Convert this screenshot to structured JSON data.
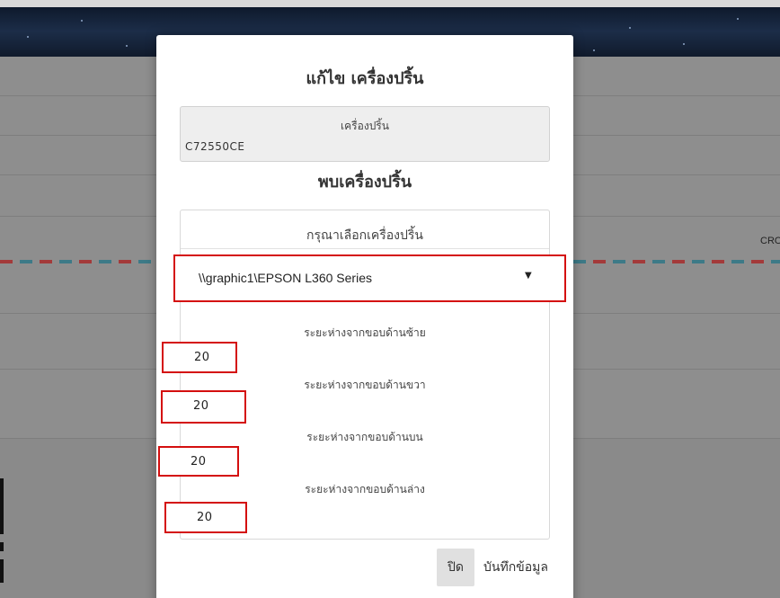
{
  "modal": {
    "title": "แก้ไข เครื่องปริ้น",
    "current_printer": {
      "label": "เครื่องปริ้น",
      "value": "C72550CE"
    },
    "found_title": "พบเครื่องปริ้น",
    "select_heading": "กรุณาเลือกเครื่องปริ้น",
    "printer_select": {
      "selected": "\\\\graphic1\\EPSON L360 Series",
      "caret": "▼"
    },
    "margins": [
      {
        "label": "ระยะห่างจากขอบด้านซ้าย",
        "value": "20"
      },
      {
        "label": "ระยะห่างจากขอบด้านขวา",
        "value": "20"
      },
      {
        "label": "ระยะห่างจากขอบด้านบน",
        "value": "20"
      },
      {
        "label": "ระยะห่างจากขอบด้านล่าง",
        "value": "20"
      }
    ],
    "buttons": {
      "close": "ปิด",
      "save": "บันทึกข้อมูล"
    }
  },
  "background": {
    "cropped_text": "CRO"
  },
  "colors": {
    "highlight_border": "#d40f0f",
    "overlay": "#8e8e8e",
    "modal_bg": "#ffffff"
  }
}
